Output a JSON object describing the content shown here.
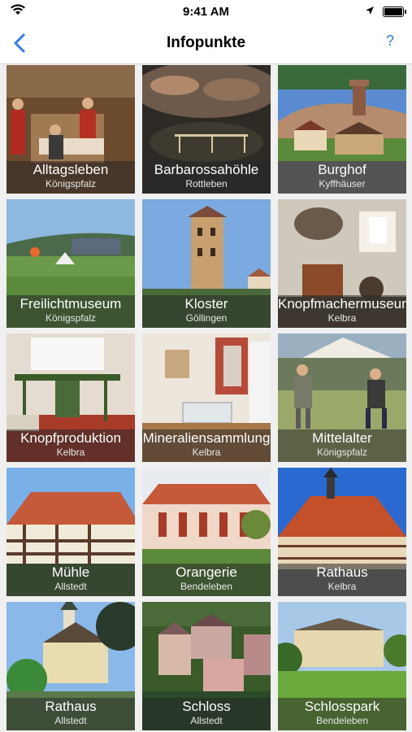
{
  "status": {
    "time": "9:41 AM"
  },
  "nav": {
    "title": "Infopunkte",
    "help_label": "?"
  },
  "tiles": [
    {
      "title": "Alltagsleben",
      "subtitle": "Königspfalz"
    },
    {
      "title": "Barbarossahöhle",
      "subtitle": "Rottleben"
    },
    {
      "title": "Burghof",
      "subtitle": "Kyffhäuser"
    },
    {
      "title": "Freilichtmuseum",
      "subtitle": "Königspfalz"
    },
    {
      "title": "Kloster",
      "subtitle": "Göllingen"
    },
    {
      "title": "Knopfmachermuseum",
      "subtitle": "Kelbra"
    },
    {
      "title": "Knopfproduktion",
      "subtitle": "Kelbra"
    },
    {
      "title": "Mineraliensammlung",
      "subtitle": "Kelbra"
    },
    {
      "title": "Mittelalter",
      "subtitle": "Königspfalz"
    },
    {
      "title": "Mühle",
      "subtitle": "Allstedt"
    },
    {
      "title": "Orangerie",
      "subtitle": "Bendeleben"
    },
    {
      "title": "Rathaus",
      "subtitle": "Kelbra"
    },
    {
      "title": "Rathaus",
      "subtitle": "Allstedt"
    },
    {
      "title": "Schloss",
      "subtitle": "Allstedt"
    },
    {
      "title": "Schlosspark",
      "subtitle": "Bendeleben"
    }
  ],
  "icons": {
    "back": "chevron-left-icon",
    "wifi": "wifi-icon",
    "location": "location-arrow-icon",
    "battery": "battery-icon"
  },
  "colors": {
    "accent": "#2f7cf6",
    "caption_bg": "rgba(40,40,40,0.55)"
  }
}
